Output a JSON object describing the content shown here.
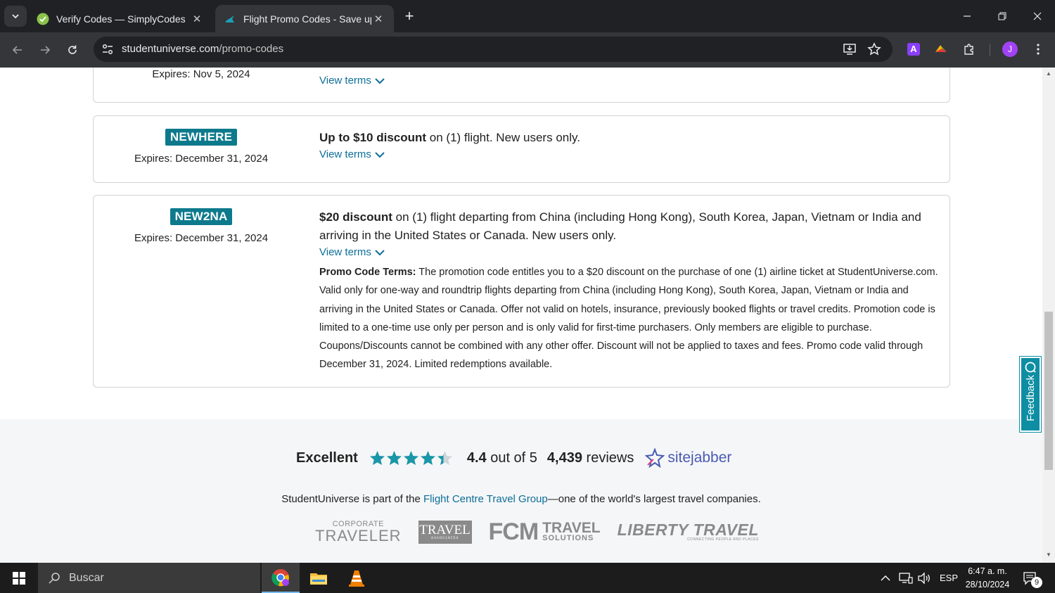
{
  "browser": {
    "tabs": [
      {
        "title": "Verify Codes — SimplyCodes",
        "active": false
      },
      {
        "title": "Flight Promo Codes - Save up to",
        "active": true
      }
    ],
    "new_tab_label": "+",
    "url_host": "studentuniverse.com",
    "url_path": "/promo-codes",
    "profile_initial": "J",
    "extension_initial": "A"
  },
  "page": {
    "partial_card": {
      "expires": "Expires: Nov 5, 2024",
      "view_terms": "View terms"
    },
    "promos": [
      {
        "code": "NEWHERE",
        "expires": "Expires: December 31, 2024",
        "headline_bold": "Up to $10 discount",
        "headline_rest": " on (1) flight. New users only.",
        "view_terms": "View terms",
        "terms_label": "",
        "terms_text": ""
      },
      {
        "code": "NEW2NA",
        "expires": "Expires: December 31, 2024",
        "headline_bold": "$20 discount",
        "headline_rest": " on (1) flight departing from China (including Hong Kong), South Korea, Japan, Vietnam or India and arriving in the United States or Canada. New users only.",
        "view_terms": "View terms",
        "terms_label": "Promo Code Terms:",
        "terms_text": " The promotion code entitles you to a $20 discount on the purchase of one (1) airline ticket at StudentUniverse.com. Valid only for one-way and roundtrip flights departing from China (including Hong Kong), South Korea, Japan, Vietnam or India and arriving in the United States or Canada. Offer not valid on hotels, insurance, previously booked flights or travel credits. Promotion code is limited to a one-time use only per person and is only valid for first-time purchasers. Only members are eligible to purchase. Coupons/Discounts cannot be combined with any other offer. Discount will not be applied to taxes and fees. Promo code valid through December 31, 2024. Limited redemptions available."
      }
    ],
    "rating": {
      "label": "Excellent",
      "stars": 4.4,
      "score": "4.4",
      "score_suffix": " out of 5",
      "review_count": "4,439",
      "review_suffix": " reviews",
      "provider": "sitejabber",
      "star_color": "#1a96a8"
    },
    "group_line": {
      "prefix": "StudentUniverse is part of the ",
      "link": "Flight Centre Travel Group",
      "suffix": "—one of the world's largest travel companies."
    },
    "logos": {
      "corporate_traveler_top": "CORPORATE",
      "corporate_traveler_main": "TRAVELER",
      "travel_associates_main": "TRAVEL",
      "travel_associates_sub": "ASSOCIATES",
      "fcm_main": "FCM",
      "fcm_travel": "TRAVEL",
      "fcm_solutions": "SOLUTIONS",
      "liberty_main": "LIBERTY TRAVEL",
      "liberty_sub": "CONNECTING PEOPLE AND PLACES"
    },
    "feedback_label": "Feedback"
  },
  "taskbar": {
    "search_placeholder": "Buscar",
    "language": "ESP",
    "time": "6:47 a. m.",
    "date": "28/10/2024",
    "notification_count": "9",
    "accent": "#76b9ed"
  },
  "colors": {
    "code_badge": "#0d7a8c",
    "link": "#0d6e99",
    "chrome_dark": "#202124",
    "chrome_toolbar": "#35363a"
  }
}
